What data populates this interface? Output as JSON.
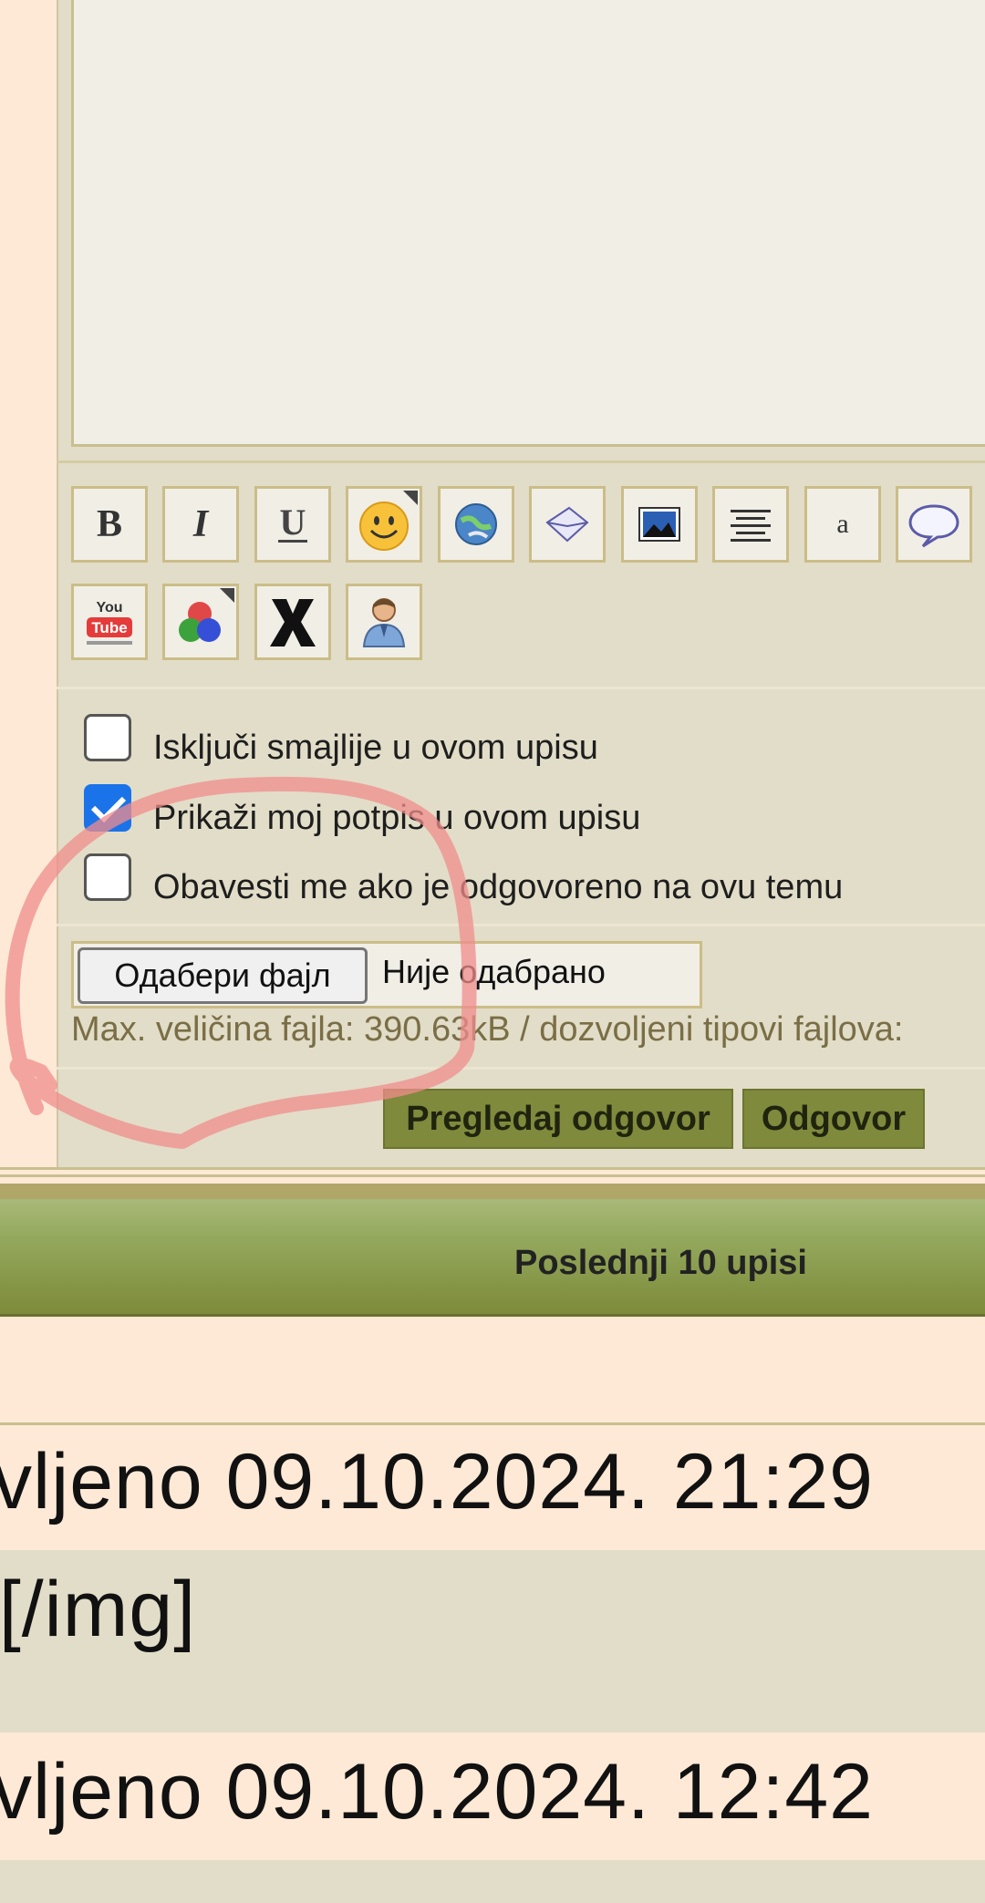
{
  "editor": {
    "toolbar": [
      {
        "name": "bold-button",
        "icon": "bold-icon"
      },
      {
        "name": "italic-button",
        "icon": "italic-icon"
      },
      {
        "name": "underline-button",
        "icon": "underline-icon"
      },
      {
        "name": "smiley-button",
        "icon": "smiley-icon"
      },
      {
        "name": "link-button",
        "icon": "globe-link-icon"
      },
      {
        "name": "email-button",
        "icon": "envelope-icon"
      },
      {
        "name": "image-button",
        "icon": "image-icon"
      },
      {
        "name": "center-button",
        "icon": "align-center-icon"
      },
      {
        "name": "font-button",
        "icon": "font-letter-icon"
      },
      {
        "name": "quote-button",
        "icon": "speech-bubble-icon"
      },
      {
        "name": "youtube-button",
        "icon": "youtube-icon"
      },
      {
        "name": "color-button",
        "icon": "color-dots-icon"
      },
      {
        "name": "remove-format-button",
        "icon": "x-mark-icon"
      },
      {
        "name": "user-button",
        "icon": "user-icon"
      }
    ],
    "youtube_text_top": "You",
    "youtube_text_bottom": "Tube",
    "font_letter": "a"
  },
  "options": {
    "disable_smilies": {
      "label": "Isključi smajlije u ovom upisu",
      "checked": false
    },
    "show_signature": {
      "label": "Prikaži moj potpis u ovom upisu",
      "checked": true
    },
    "notify": {
      "label": "Obavesti me ako je odgovoreno na ovu temu",
      "checked": false
    }
  },
  "upload": {
    "button_label": "Одабери фајл",
    "status": "Није одабрано",
    "max_size_text": "Max. veličina fajla: 390.63kB / dozvoljeni tipovi fajlova:"
  },
  "actions": {
    "preview_label": "Pregledaj odgovor",
    "reply_label": "Odgovor"
  },
  "last_posts": {
    "title": "Poslednji 10 upisi",
    "rows": [
      "vljeno 09.10.2024. 21:29",
      "][/img]",
      "vljeno 09.10.2024. 12:42"
    ]
  },
  "colors": {
    "accent_green": "#7f8a3c",
    "checkbox_blue": "#1a73e8",
    "annotation_red": "#f08c8c"
  }
}
